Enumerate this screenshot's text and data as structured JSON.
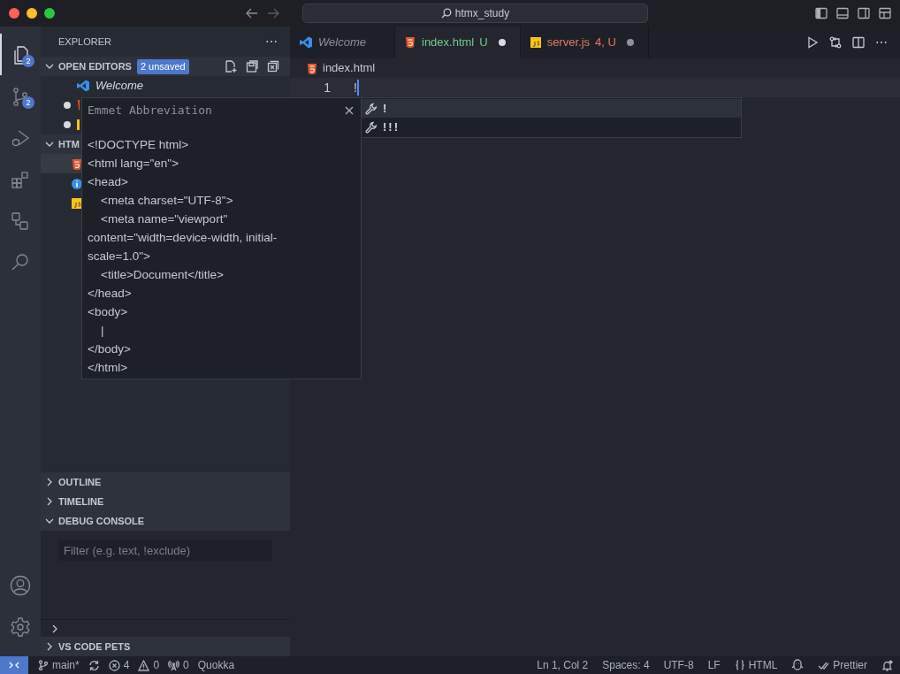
{
  "window": {
    "title": "htmx_study"
  },
  "activity_bar": {
    "items": [
      {
        "kind": "explorer",
        "badge": "2",
        "selected": true
      },
      {
        "kind": "source-control",
        "badge": "2",
        "selected": false
      },
      {
        "kind": "run-debug",
        "selected": false
      },
      {
        "kind": "extensions",
        "selected": false
      },
      {
        "kind": "remote",
        "selected": false
      },
      {
        "kind": "search",
        "selected": false
      }
    ],
    "bottom": [
      {
        "kind": "account"
      },
      {
        "kind": "settings"
      }
    ]
  },
  "sidebar": {
    "title": "EXPLORER",
    "more_actions": "⋯",
    "open_editors": {
      "title": "OPEN EDITORS",
      "expanded": true,
      "badge": "2 unsaved",
      "items": [
        {
          "kind": "vscode",
          "label": "Welcome",
          "modified": false
        },
        {
          "kind": "html",
          "modified": true
        },
        {
          "kind": "js",
          "modified": true
        }
      ]
    },
    "folder": {
      "title": "HTM",
      "expanded": true,
      "items": [
        {
          "kind": "html",
          "selected": true
        },
        {
          "kind": "info",
          "selected": false
        },
        {
          "kind": "js",
          "selected": false
        }
      ]
    },
    "panels": [
      {
        "title": "OUTLINE",
        "expanded": false
      },
      {
        "title": "TIMELINE",
        "expanded": false
      },
      {
        "title": "DEBUG CONSOLE",
        "expanded": true
      }
    ],
    "filter": {
      "placeholder": "Filter (e.g. text, !exclude)"
    },
    "bottom_panels": [
      {
        "expanded": false
      },
      {
        "title": "VS CODE PETS",
        "expanded": false
      }
    ]
  },
  "tabs": [
    {
      "kind": "vscode",
      "label": "Welcome",
      "preview": true,
      "selected": false
    },
    {
      "kind": "html",
      "label": "index.html",
      "decoration": "U",
      "color": "#73c991",
      "modified": true,
      "selected": true
    },
    {
      "kind": "js",
      "label": "server.js",
      "decoration": "4, U",
      "color": "#e2786a",
      "modified": true,
      "selected": false
    }
  ],
  "editor_actions": {
    "more_actions": "⋯"
  },
  "editor": {
    "breadcrumb": {
      "kind": "html",
      "label": "index.html"
    },
    "lines": [
      {
        "number": "1",
        "text": "!"
      }
    ],
    "suggestions": [
      {
        "label": "!",
        "selected": true
      },
      {
        "label": "!!!",
        "selected": false
      }
    ],
    "details": {
      "title": "Emmet Abbreviation",
      "body": "<!DOCTYPE html>\n<html lang=\"en\">\n<head>\n\t<meta charset=\"UTF-8\">\n\t<meta name=\"viewport\" content=\"width=device-width, initial-scale=1.0\">\n\t<title>Document</title>\n</head>\n<body>\n\t|\n</body>\n</html>"
    }
  },
  "status_bar": {
    "left": [
      {
        "kind": "remote"
      },
      {
        "kind": "branch",
        "text": "main*"
      },
      {
        "kind": "sync"
      },
      {
        "kind": "errors",
        "text": "4"
      },
      {
        "kind": "warnings",
        "text": "0"
      },
      {
        "kind": "ports",
        "text": "0"
      },
      {
        "kind": "plain",
        "text": "Quokka"
      }
    ],
    "right": [
      {
        "kind": "plain",
        "text": "Ln 1, Col 2"
      },
      {
        "kind": "plain",
        "text": "Spaces: 4"
      },
      {
        "kind": "plain",
        "text": "UTF-8"
      },
      {
        "kind": "plain",
        "text": "LF"
      },
      {
        "kind": "language",
        "text": "HTML"
      },
      {
        "kind": "feedback"
      },
      {
        "kind": "prettier",
        "text": "Prettier"
      },
      {
        "kind": "bell"
      }
    ]
  }
}
